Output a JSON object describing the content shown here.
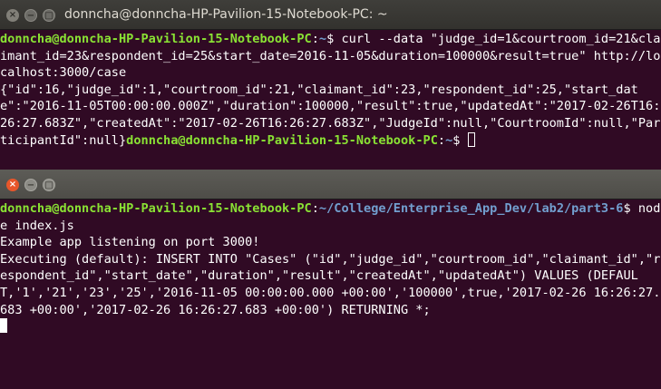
{
  "window1": {
    "title": "donncha@donncha-HP-Pavilion-15-Notebook-PC: ~",
    "controls": {
      "close": "×",
      "minimize": "−",
      "maximize": "□"
    },
    "prompt_user": "donncha@donncha-HP-Pavilion-15-Notebook-PC",
    "prompt_path": "~",
    "prompt_suffix": "$ ",
    "command": "curl --data \"judge_id=1&courtroom_id=21&claimant_id=23&respondent_id=25&start_date=2016-11-05&duration=100000&result=true\" http://localhost:3000/case",
    "response": "{\"id\":16,\"judge_id\":1,\"courtroom_id\":21,\"claimant_id\":23,\"respondent_id\":25,\"start_date\":\"2016-11-05T00:00:00.000Z\",\"duration\":100000,\"result\":true,\"updatedAt\":\"2017-02-26T16:26:27.683Z\",\"createdAt\":\"2017-02-26T16:26:27.683Z\",\"JudgeId\":null,\"CourtroomId\":null,\"ParticipantId\":null}",
    "prompt2_user": "donncha@donncha-HP-Pavilion-15-Notebook-PC",
    "prompt2_path": "~",
    "prompt2_suffix": "$ "
  },
  "window2": {
    "controls": {
      "close": "×",
      "minimize": "−",
      "maximize": "□"
    },
    "prompt_user": "donncha@donncha-HP-Pavilion-15-Notebook-PC",
    "prompt_path": "~/College/Enterprise_App_Dev/lab2/part3-6",
    "prompt_suffix": "$ ",
    "command": "node index.js",
    "output_lines": [
      "Example app listening on port 3000!",
      "Executing (default): INSERT INTO \"Cases\" (\"id\",\"judge_id\",\"courtroom_id\",\"claimant_id\",\"respondent_id\",\"start_date\",\"duration\",\"result\",\"createdAt\",\"updatedAt\") VALUES (DEFAULT,'1','21','23','25','2016-11-05 00:00:00.000 +00:00','100000',true,'2017-02-26 16:26:27.683 +00:00','2017-02-26 16:26:27.683 +00:00') RETURNING *;"
    ]
  }
}
